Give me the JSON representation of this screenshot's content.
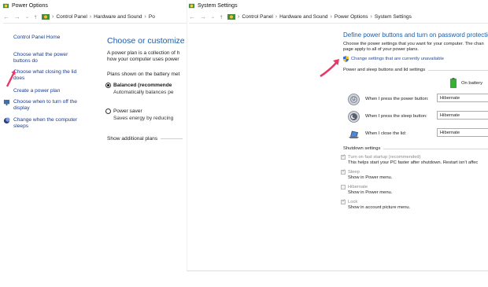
{
  "left_window": {
    "title": "Power Options",
    "address": {
      "crumbs": [
        "Control Panel",
        "Hardware and Sound",
        "Po"
      ]
    },
    "sidebar": {
      "home": "Control Panel Home",
      "items": [
        {
          "label": "Choose what the power buttons do"
        },
        {
          "label": "Choose what closing the lid does"
        },
        {
          "label": "Create a power plan"
        },
        {
          "label": "Choose when to turn off the display"
        },
        {
          "label": "Change when the computer sleeps"
        }
      ]
    },
    "main": {
      "heading": "Choose or customize a p",
      "para_line1": "A power plan is a collection of h",
      "para_line2": "how your computer uses power",
      "plans_header": "Plans shown on the battery met",
      "plans": [
        {
          "name": "Balanced (recommende",
          "desc": "Automatically balances pe",
          "selected": true
        },
        {
          "name": "Power saver",
          "desc": "Saves energy by reducing",
          "selected": false
        }
      ],
      "show_additional": "Show additional plans"
    }
  },
  "right_window": {
    "title": "System Settings",
    "address": {
      "crumbs": [
        "Control Panel",
        "Hardware and Sound",
        "Power Options",
        "System Settings"
      ]
    },
    "heading": "Define power buttons and turn on password protectio",
    "para_line1": "Choose the power settings that you want for your computer. The chan",
    "para_line2": "page apply to all of your power plans.",
    "change_link": "Change settings that are currently unavailable",
    "section_buttons": "Power and sleep buttons and lid settings",
    "on_battery": "On battery",
    "settings": [
      {
        "label": "When I press the power button:",
        "value": "Hibernate",
        "icon": "power-button-icon"
      },
      {
        "label": "When I press the sleep button:",
        "value": "Hibernate",
        "icon": "sleep-button-icon"
      },
      {
        "label": "When I close the lid:",
        "value": "Hibernate",
        "icon": "laptop-lid-icon"
      }
    ],
    "section_shutdown": "Shutdown settings",
    "shutdown": [
      {
        "label": "Turn on fast startup (recommended)",
        "desc": "This helps start your PC faster after shutdown. Restart isn't affec",
        "checked": true
      },
      {
        "label": "Sleep",
        "desc": "Show in Power menu.",
        "checked": true
      },
      {
        "label": "Hibernate",
        "desc": "Show in Power menu.",
        "checked": false
      },
      {
        "label": "Lock",
        "desc": "Show in account picture menu.",
        "checked": true
      }
    ]
  },
  "colors": {
    "link": "#1a3a8a",
    "heading": "#1c5ca8",
    "arrow": "#e8386a"
  }
}
